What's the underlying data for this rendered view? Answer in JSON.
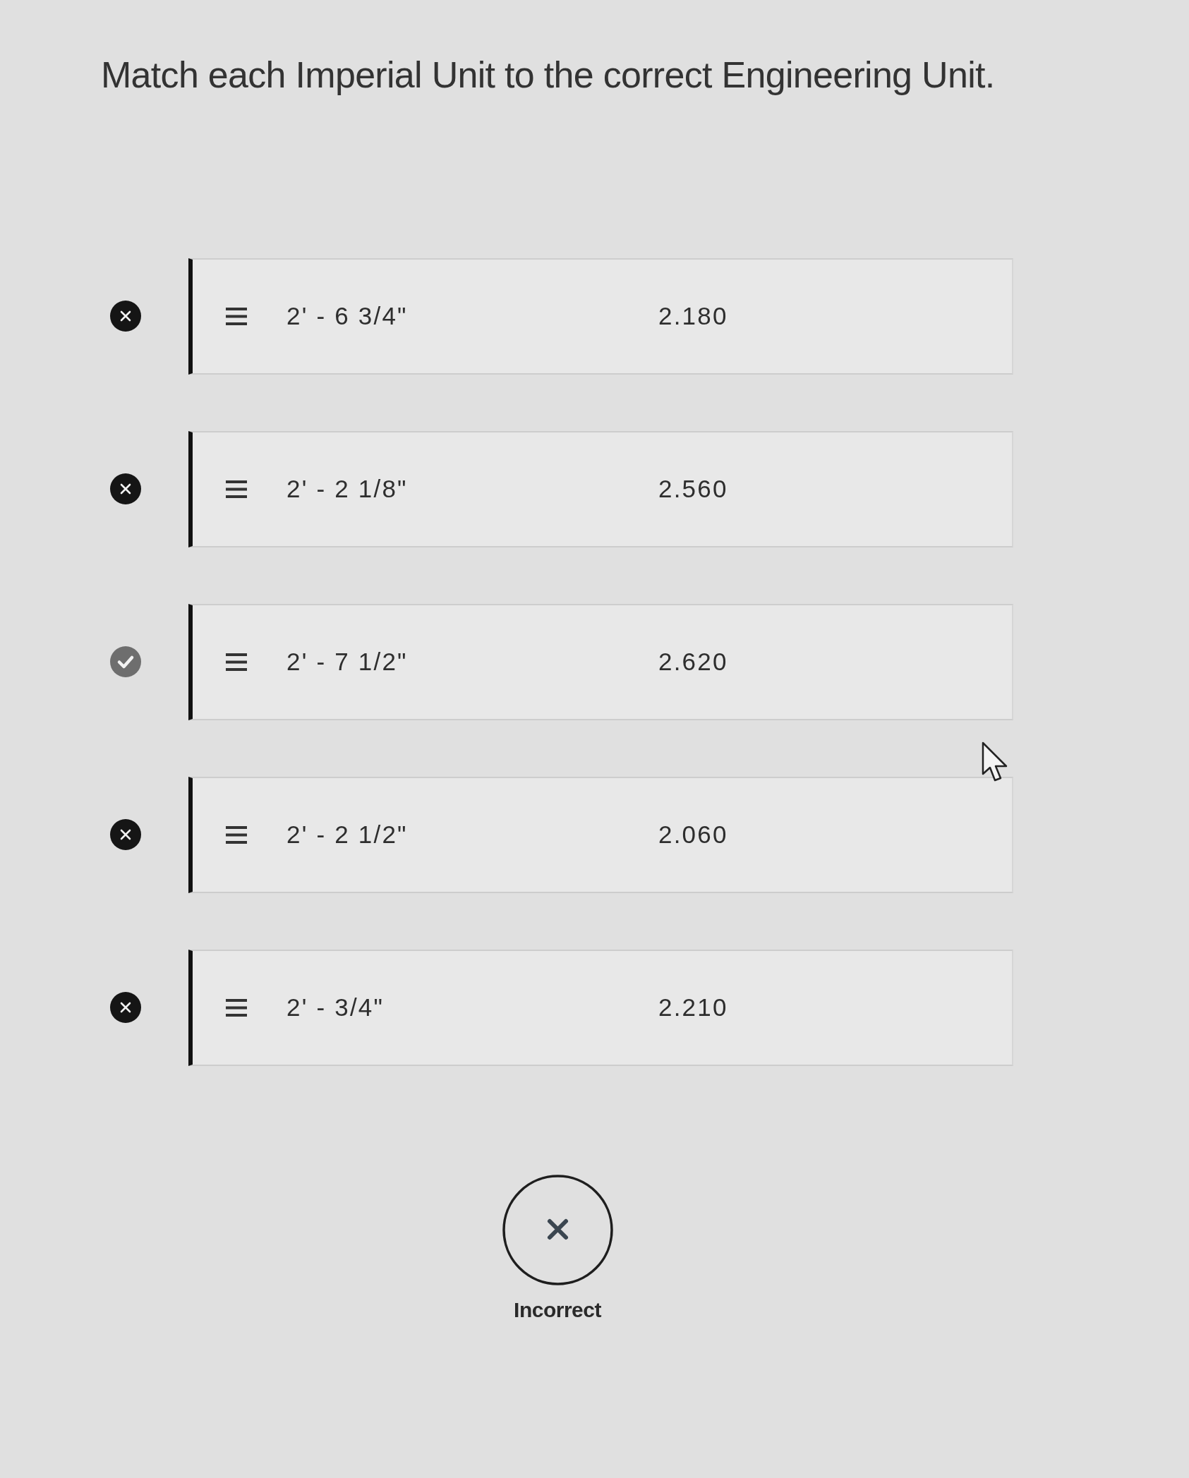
{
  "question": "Match each Imperial Unit to the correct Engineering Unit.",
  "rows": [
    {
      "imperial": "2' - 6 3/4\"",
      "engineering": "2.180",
      "correct": false
    },
    {
      "imperial": "2' - 2 1/8\"",
      "engineering": "2.560",
      "correct": false
    },
    {
      "imperial": "2' - 7 1/2\"",
      "engineering": "2.620",
      "correct": true
    },
    {
      "imperial": "2' - 2 1/2\"",
      "engineering": "2.060",
      "correct": false
    },
    {
      "imperial": "2' - 3/4\"",
      "engineering": "2.210",
      "correct": false
    }
  ],
  "result": {
    "label": "Incorrect",
    "correct": false
  }
}
